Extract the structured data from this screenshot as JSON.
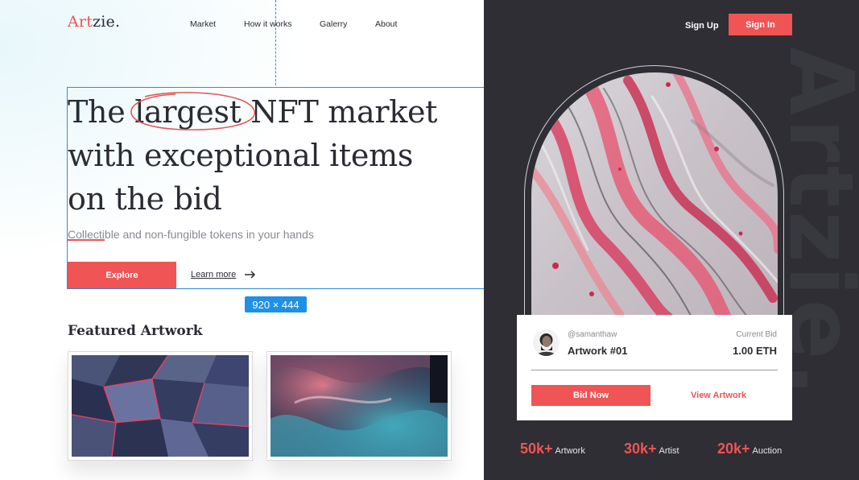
{
  "brand": {
    "logo_accent": "Art",
    "logo_rest": "zie.",
    "accent_color": "#f05454"
  },
  "nav": {
    "items": [
      "Market",
      "How it works",
      "Galerry",
      "About"
    ]
  },
  "auth": {
    "signup_label": "Sign Up",
    "signin_label": "Sign In"
  },
  "hero": {
    "title_line1_before": "The ",
    "title_highlight": "largest",
    "title_line1_after": " NFT market",
    "title_line2": "with exceptional items",
    "title_line3": "on the bid",
    "subtitle": "Collectible and non-fungible tokens in your hands",
    "explore_label": "Explore",
    "learn_more_label": "Learn more"
  },
  "editor_overlay": {
    "size_badge": "920 × 444"
  },
  "featured": {
    "title": "Featured Artwork"
  },
  "showcase": {
    "watermark": "Artzie.",
    "handle": "@samanthaw",
    "artwork_name": "Artwork #01",
    "bid_label": "Current Bid",
    "bid_value": "1.00 ETH",
    "bid_now_label": "Bid Now",
    "view_artwork_label": "View Artwork"
  },
  "stats": [
    {
      "value": "50k+",
      "label": "Artwork"
    },
    {
      "value": "30k+",
      "label": "Artist"
    },
    {
      "value": "20k+",
      "label": "Auction"
    }
  ]
}
